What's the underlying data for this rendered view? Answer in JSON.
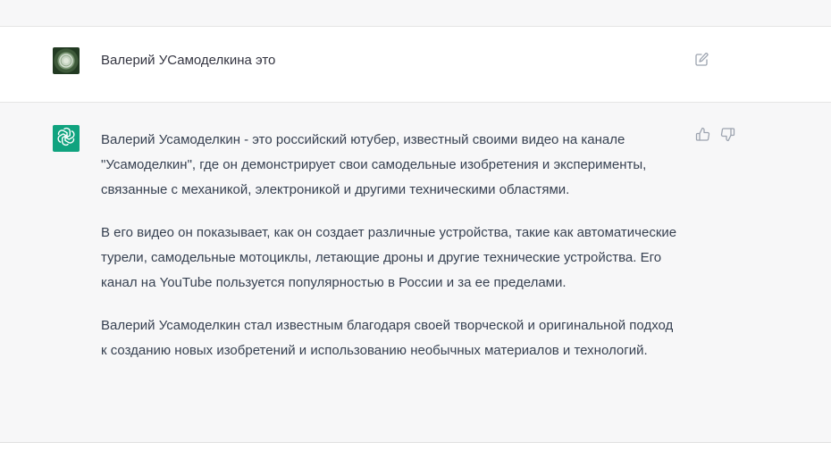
{
  "user_message": {
    "text": "Валерий УСамоделкина это"
  },
  "assistant_message": {
    "paragraphs": [
      "Валерий Усамоделкин - это российский ютубер, известный своими видео на канале \"Усамоделкин\", где он демонстрирует свои самодельные изобретения и эксперименты, связанные с механикой, электроникой и другими техническими областями.",
      "В его видео он показывает, как он создает различные устройства, такие как автоматические турели, самодельные мотоциклы, летающие дроны и другие технические устройства. Его канал на YouTube пользуется популярностью в России и за ее пределами.",
      "Валерий Усамоделкин стал известным благодаря своей творческой и оригинальной подход к созданию новых изобретений и использованию необычных материалов и технологий."
    ]
  },
  "icons": {
    "edit": "edit-icon",
    "thumbs_up": "thumbs-up-icon",
    "thumbs_down": "thumbs-down-icon",
    "bot_logo": "openai-logo-icon"
  },
  "colors": {
    "bot_avatar_bg": "#10a37f",
    "assistant_row_bg": "#f7f7f8",
    "text": "#374151"
  }
}
